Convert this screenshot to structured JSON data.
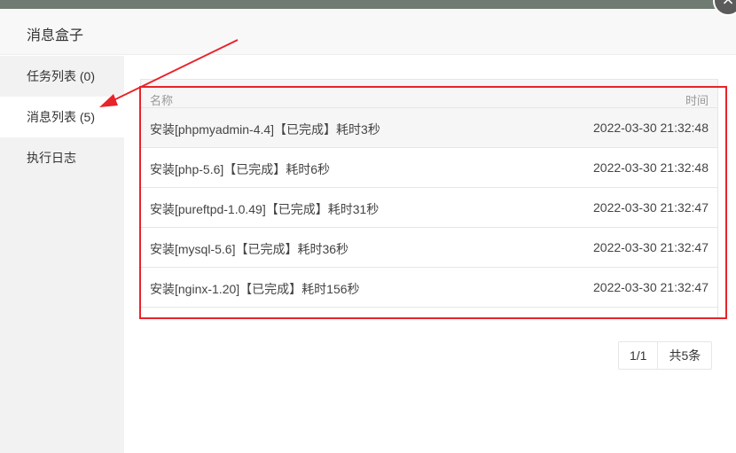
{
  "modal": {
    "title": "消息盒子",
    "close_symbol": "×"
  },
  "sidebar": {
    "items": [
      {
        "label": "任务列表 (0)",
        "active": false
      },
      {
        "label": "消息列表 (5)",
        "active": true
      },
      {
        "label": "执行日志",
        "active": false
      }
    ]
  },
  "table": {
    "headers": {
      "name": "名称",
      "time": "时间"
    },
    "rows": [
      {
        "name": "安装[phpmyadmin-4.4]【已完成】耗时3秒",
        "time": "2022-03-30 21:32:48"
      },
      {
        "name": "安装[php-5.6]【已完成】耗时6秒",
        "time": "2022-03-30 21:32:48"
      },
      {
        "name": "安装[pureftpd-1.0.49]【已完成】耗时31秒",
        "time": "2022-03-30 21:32:47"
      },
      {
        "name": "安装[mysql-5.6]【已完成】耗时36秒",
        "time": "2022-03-30 21:32:47"
      },
      {
        "name": "安装[nginx-1.20]【已完成】耗时156秒",
        "time": "2022-03-30 21:32:47"
      }
    ]
  },
  "pagination": {
    "page": "1/1",
    "total": "共5条"
  },
  "annotation": {
    "color": "#e8232a"
  }
}
